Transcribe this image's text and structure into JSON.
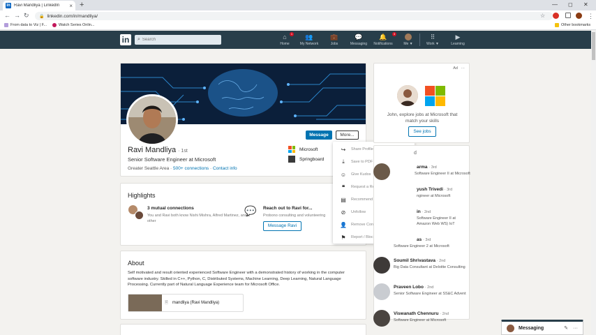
{
  "browser": {
    "tab_title": "Ravi Mandliya | LinkedIn",
    "tab_close": "×",
    "new_tab": "+",
    "url": "linkedin.com/in/mandliya/",
    "win_min": "—",
    "win_max": "◻",
    "win_close": "✕",
    "back_glyph": "←",
    "forward_glyph": "→",
    "reload_glyph": "↻",
    "star_glyph": "☆",
    "menu_glyph": "⋮",
    "bookmarks": [
      "From data to Viz | F...",
      "Watch Series Onlin..."
    ],
    "other_bookmarks": "Other bookmarks"
  },
  "nav": {
    "logo": "in",
    "search_placeholder": "Search",
    "items": [
      {
        "label": "Home",
        "badge": "1"
      },
      {
        "label": "My Network"
      },
      {
        "label": "Jobs"
      },
      {
        "label": "Messaging"
      },
      {
        "label": "Notifications",
        "badge": "3"
      },
      {
        "label": "Me ▼"
      },
      {
        "label": "Work ▼"
      },
      {
        "label": "Learning"
      }
    ]
  },
  "profile": {
    "name": "Ravi Mandliya",
    "degree": "· 1st",
    "headline": "Senior Software Engineer at Microsoft",
    "location": "Greater Seattle Area ·",
    "connections": "500+ connections",
    "contact": "Contact info",
    "message_button": "Message",
    "more_button": "More...",
    "orgs": [
      "Microsoft",
      "Springboard"
    ]
  },
  "more_menu": [
    {
      "label": "Share Profile via Message",
      "icon": "share-icon"
    },
    {
      "label": "Save to PDF",
      "icon": "download-icon"
    },
    {
      "label": "Give Kudos",
      "icon": "kudos-icon"
    },
    {
      "label": "Request a Recommendation",
      "icon": "quote-icon"
    },
    {
      "label": "Recommend",
      "icon": "recommend-icon"
    },
    {
      "label": "Unfollow",
      "icon": "unfollow-icon"
    },
    {
      "label": "Remove Connection",
      "icon": "remove-connection-icon"
    },
    {
      "label": "Report / Block",
      "icon": "flag-icon"
    }
  ],
  "highlights": {
    "title": "Highlights",
    "mutual_title": "3 mutual connections",
    "mutual_sub": "You and Ravi both know Nishi Mishra, Alfred Martinez, and 1 other",
    "reach_title": "Reach out to Ravi for...",
    "reach_sub": "Probono consulting and volunteering",
    "reach_button": "Message Ravi"
  },
  "about": {
    "title": "About",
    "text": "Self motivated and result oriented experienced Software Engineer with a demonstrated history of working in the computer software industry. Skilled in C++, Python, C, Distributed Systems, Machine Learning, Deep Learning, Natural Language Processing. Currently part of Natural Language Experience team for Microsoft Office.",
    "media_title": "mandliya (Ravi Mandliya)"
  },
  "ad": {
    "label": "Ad",
    "more": "···",
    "text": "John, explore jobs at Microsoft that match your skills",
    "button": "See jobs"
  },
  "pav_header": "d",
  "pav": [
    {
      "name": "arma",
      "degree": "· 3rd",
      "title": "Software Engineer II at Microsoft"
    },
    {
      "name": "yush Trivedi",
      "degree": "· 3rd",
      "title": "ngineer at Microsoft"
    },
    {
      "name": "in",
      "degree": "· 2nd",
      "title": "Software Engineer II at Amazon Web WS) IoT"
    },
    {
      "name": "as",
      "degree": "· 3rd",
      "title": "Software Engineer 2 at Microsoft"
    },
    {
      "name": "Soumil Shrivastava",
      "degree": "· 2nd",
      "title": "Big Data Consultant at Deloitte Consulting"
    },
    {
      "name": "Praveen Lobo",
      "degree": "· 2nd",
      "title": "Senior Software Engineer at SS&C Advent"
    },
    {
      "name": "Viswanath Chennuru",
      "degree": "· 2nd",
      "title": "Software Engineer at Microsoft"
    }
  ],
  "messaging": {
    "label": "Messaging",
    "compose": "✎",
    "more": "···",
    "collapse": "︿"
  },
  "colors": {
    "nav_bg": "#283e4a",
    "brand_blue": "#0073b1",
    "badge_red": "#d11124"
  }
}
